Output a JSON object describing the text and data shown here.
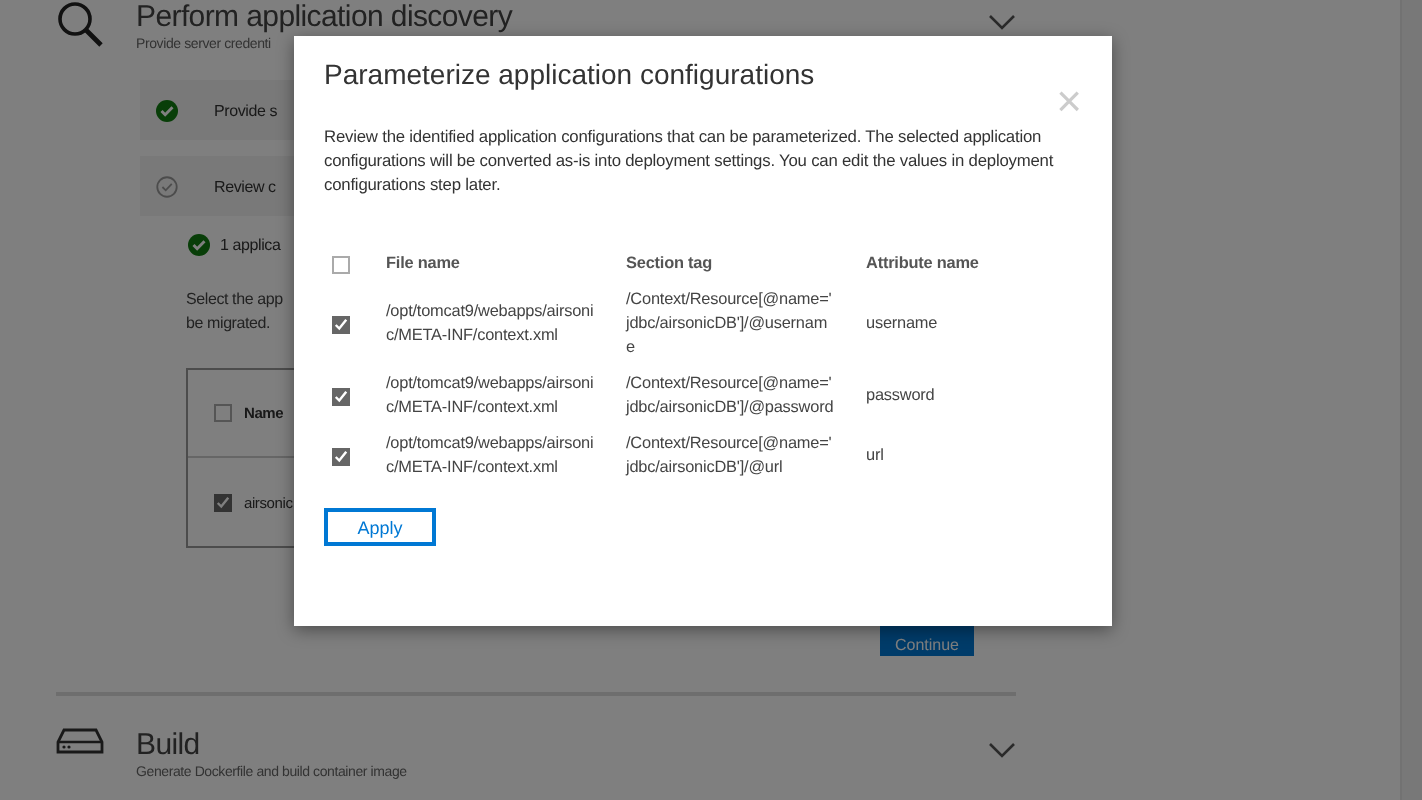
{
  "discovery": {
    "title": "Perform application discovery",
    "subtitle": "Provide server credenti",
    "expanded": true
  },
  "steps": [
    {
      "label": "Provide s",
      "done": true
    },
    {
      "label": "Review c",
      "done": false
    }
  ],
  "result": "1 applica",
  "instructions": [
    "Select the app",
    "be migrated."
  ],
  "app_table": {
    "column": "Name",
    "header_checked": false,
    "rows": [
      {
        "name": "airsonic",
        "checked": true
      }
    ]
  },
  "continue_button": "Continue",
  "build": {
    "title": "Build",
    "subtitle": "Generate Dockerfile and build container image",
    "expanded": false
  },
  "dialog": {
    "title": "Parameterize application configurations",
    "close": "×",
    "description": "Review the identified application configurations that can be parameterized. The selected application configurations will be converted as-is into deployment settings. You can edit the values in deployment configurations step later.",
    "columns": [
      "File name",
      "Section tag",
      "Attribute name"
    ],
    "header_checked": false,
    "rows": [
      {
        "file": "/opt/tomcat9/webapps/airsonic/META-INF/context.xml",
        "section": "/Context/Resource[@name='jdbc/airsonicDB']/@username",
        "attribute": "username",
        "checked": true
      },
      {
        "file": "/opt/tomcat9/webapps/airsonic/META-INF/context.xml",
        "section": "/Context/Resource[@name='jdbc/airsonicDB']/@password",
        "attribute": "password",
        "checked": true
      },
      {
        "file": "/opt/tomcat9/webapps/airsonic/META-INF/context.xml",
        "section": "/Context/Resource[@name='jdbc/airsonicDB']/@url",
        "attribute": "url",
        "checked": true
      }
    ],
    "apply_button": "Apply"
  }
}
